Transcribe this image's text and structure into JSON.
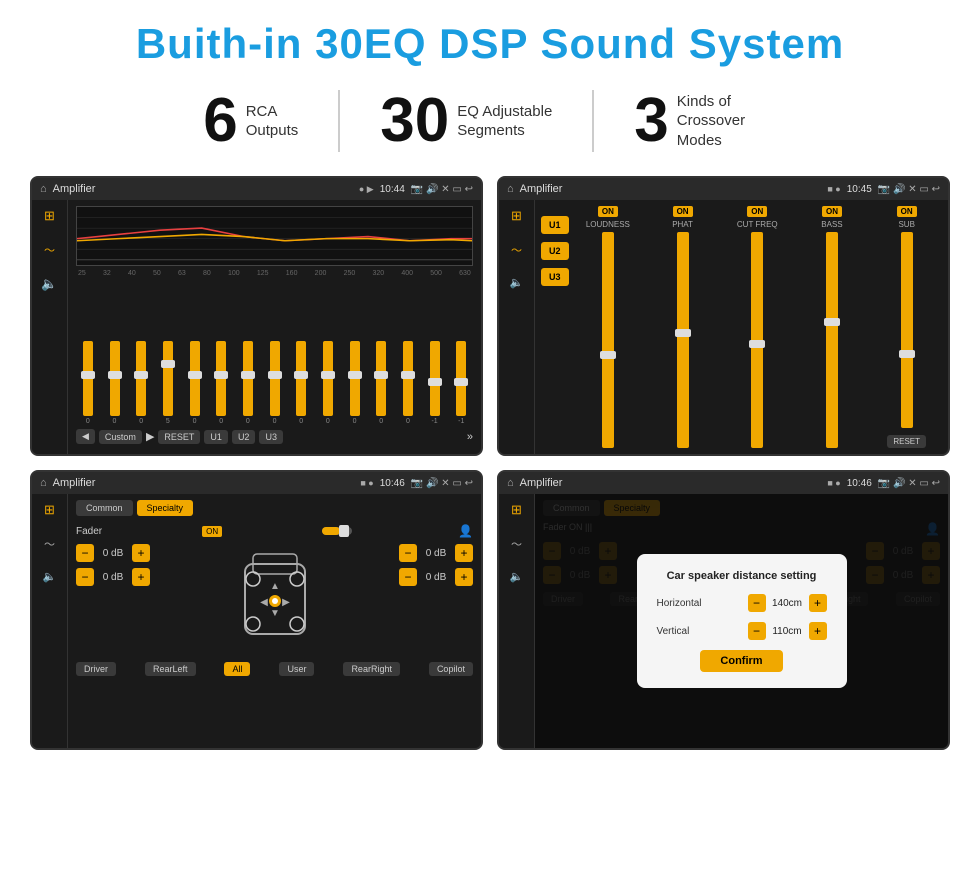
{
  "page": {
    "title": "Buith-in 30EQ DSP Sound System",
    "stats": [
      {
        "number": "6",
        "label": "RCA\nOutputs"
      },
      {
        "number": "30",
        "label": "EQ Adjustable\nSegments"
      },
      {
        "number": "3",
        "label": "Kinds of\nCrossover Modes"
      }
    ],
    "screens": [
      {
        "id": "eq-screen",
        "topbar": {
          "title": "Amplifier",
          "time": "10:44"
        },
        "type": "eq"
      },
      {
        "id": "amp-screen",
        "topbar": {
          "title": "Amplifier",
          "time": "10:45"
        },
        "type": "amplifier"
      },
      {
        "id": "fader-screen",
        "topbar": {
          "title": "Amplifier",
          "time": "10:46"
        },
        "type": "fader"
      },
      {
        "id": "dist-screen",
        "topbar": {
          "title": "Amplifier",
          "time": "10:46"
        },
        "type": "distance"
      }
    ],
    "eq": {
      "freqs": [
        "25",
        "32",
        "40",
        "50",
        "63",
        "80",
        "100",
        "125",
        "160",
        "200",
        "250",
        "320",
        "400",
        "500",
        "630"
      ],
      "values": [
        "0",
        "0",
        "0",
        "5",
        "0",
        "0",
        "0",
        "0",
        "0",
        "0",
        "0",
        "0",
        "0",
        "-1",
        "0",
        "-1"
      ],
      "preset": "Custom",
      "buttons": [
        "RESET",
        "U1",
        "U2",
        "U3"
      ]
    },
    "amplifier": {
      "u_buttons": [
        "U1",
        "U2",
        "U3"
      ],
      "controls": [
        {
          "label": "LOUDNESS",
          "on": true
        },
        {
          "label": "PHAT",
          "on": true
        },
        {
          "label": "CUT FREQ",
          "on": true
        },
        {
          "label": "BASS",
          "on": true
        },
        {
          "label": "SUB",
          "on": true
        }
      ],
      "reset_label": "RESET"
    },
    "fader": {
      "tabs": [
        "Common",
        "Specialty"
      ],
      "fader_label": "Fader",
      "on_label": "ON",
      "db_rows": [
        {
          "label": "",
          "value": "0 dB"
        },
        {
          "label": "",
          "value": "0 dB"
        },
        {
          "label": "",
          "value": "0 dB"
        },
        {
          "label": "",
          "value": "0 dB"
        }
      ],
      "bottom_btns": [
        "Driver",
        "RearLeft",
        "All",
        "User",
        "RearRight",
        "Copilot"
      ]
    },
    "distance": {
      "tabs": [
        "Common",
        "Specialty"
      ],
      "dialog": {
        "title": "Car speaker distance setting",
        "rows": [
          {
            "label": "Horizontal",
            "value": "140cm"
          },
          {
            "label": "Vertical",
            "value": "110cm"
          }
        ],
        "confirm_label": "Confirm",
        "db_values": [
          "0 dB",
          "0 dB"
        ]
      }
    }
  }
}
